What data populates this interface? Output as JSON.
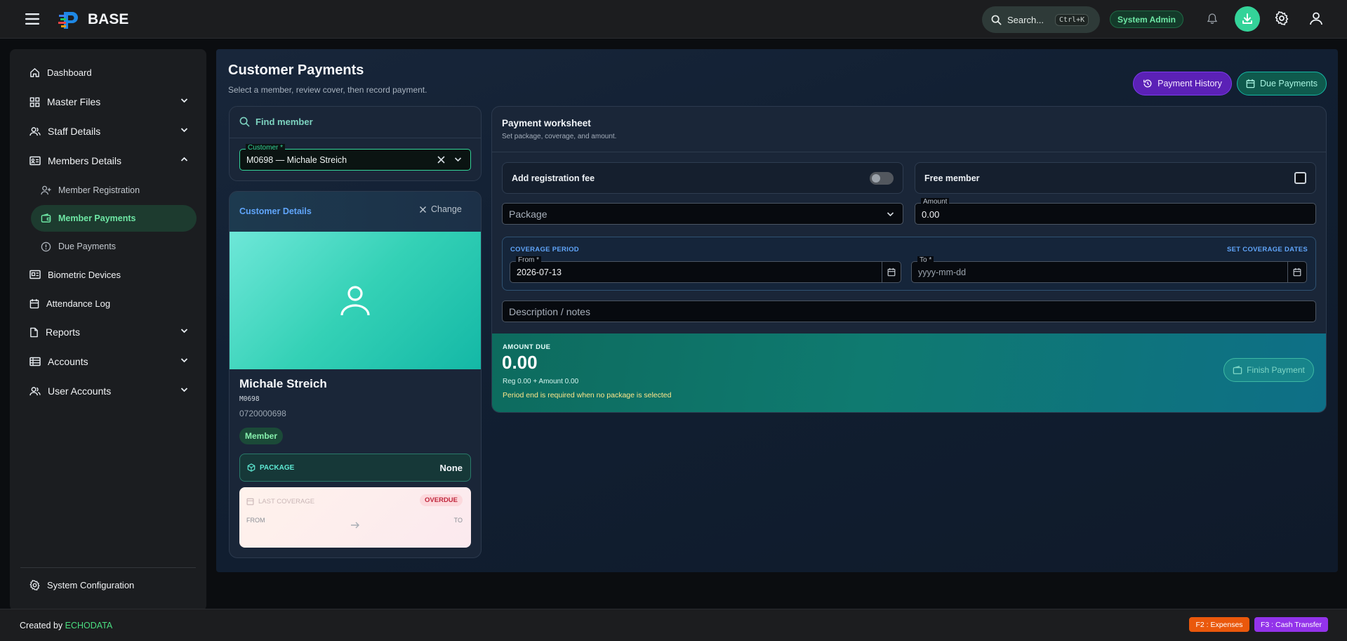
{
  "header": {
    "app_name": "BASE",
    "search_label": "Search...",
    "search_shortcut": "Ctrl+K",
    "role": "System Admin",
    "icons": [
      "menu-icon",
      "logo",
      "bell-icon",
      "download-icon",
      "gear-icon",
      "user-icon"
    ]
  },
  "sidebar": {
    "items": [
      {
        "label": "Dashboard",
        "icon": "home-icon"
      },
      {
        "label": "Master Files",
        "icon": "grid-icon",
        "expandable": true
      },
      {
        "label": "Staff Details",
        "icon": "users-icon",
        "expandable": true
      },
      {
        "label": "Members Details",
        "icon": "id-card-icon",
        "expandable": true,
        "expanded": true
      },
      {
        "label": "Member Registration",
        "icon": "user-add-icon",
        "sub": true
      },
      {
        "label": "Member Payments",
        "icon": "wallet-icon",
        "sub": true,
        "active": true
      },
      {
        "label": "Due Payments",
        "icon": "alert-circle-icon",
        "sub": true
      },
      {
        "label": "Biometric Devices",
        "icon": "fingerprint-card-icon"
      },
      {
        "label": "Attendance Log",
        "icon": "calendar-icon"
      },
      {
        "label": "Reports",
        "icon": "document-icon",
        "expandable": true
      },
      {
        "label": "Accounts",
        "icon": "ledger-icon",
        "expandable": true
      },
      {
        "label": "User Accounts",
        "icon": "users-icon",
        "expandable": true
      }
    ],
    "footer_item": "System Configuration"
  },
  "page": {
    "title": "Customer Payments",
    "subtitle": "Select a member, review cover, then record payment.",
    "history_button": "Payment History",
    "due_button": "Due Payments"
  },
  "find_member": {
    "title": "Find member",
    "customer_label": "Customer *",
    "customer_value": "M0698 — Michale Streich"
  },
  "customer_details": {
    "title": "Customer Details",
    "change_label": "Change",
    "name": "Michale Streich",
    "code": "M0698",
    "phone": "0720000698",
    "badge": "Member",
    "package_label": "PACKAGE",
    "package_value": "None",
    "coverage_label": "LAST COVERAGE",
    "coverage_status": "OVERDUE",
    "from_label": "FROM",
    "to_label": "TO"
  },
  "worksheet": {
    "title": "Payment worksheet",
    "subtitle": "Set package, coverage, and amount.",
    "registration_fee_label": "Add registration fee",
    "registration_fee_on": false,
    "free_member_label": "Free member",
    "free_member_checked": false,
    "package_placeholder": "Package",
    "amount_label": "Amount",
    "amount_value": "0.00",
    "coverage_period_label": "COVERAGE PERIOD",
    "set_dates_label": "SET COVERAGE DATES",
    "from_label": "From *",
    "from_value": "2026-07-13",
    "to_label": "To *",
    "to_placeholder": "yyyy-mm-dd",
    "notes_placeholder": "Description / notes",
    "amount_due_label": "AMOUNT DUE",
    "amount_due_value": "0.00",
    "breakdown": "Reg 0.00 + Amount 0.00",
    "warning": "Period end is required when no package is selected",
    "finish_button": "Finish Payment"
  },
  "footer": {
    "credit_prefix": "Created by",
    "credit_brand": "ECHODATA",
    "shortcut_expenses": "F2 : Expenses",
    "shortcut_transfer": "F3 : Cash Transfer"
  },
  "colors": {
    "accent_green": "#6ee7a5",
    "accent_teal": "#14b8a6",
    "accent_blue": "#60a5fa",
    "purple": "#5b21b6",
    "orange": "#ea580c",
    "overdue_red": "#c0263c"
  }
}
